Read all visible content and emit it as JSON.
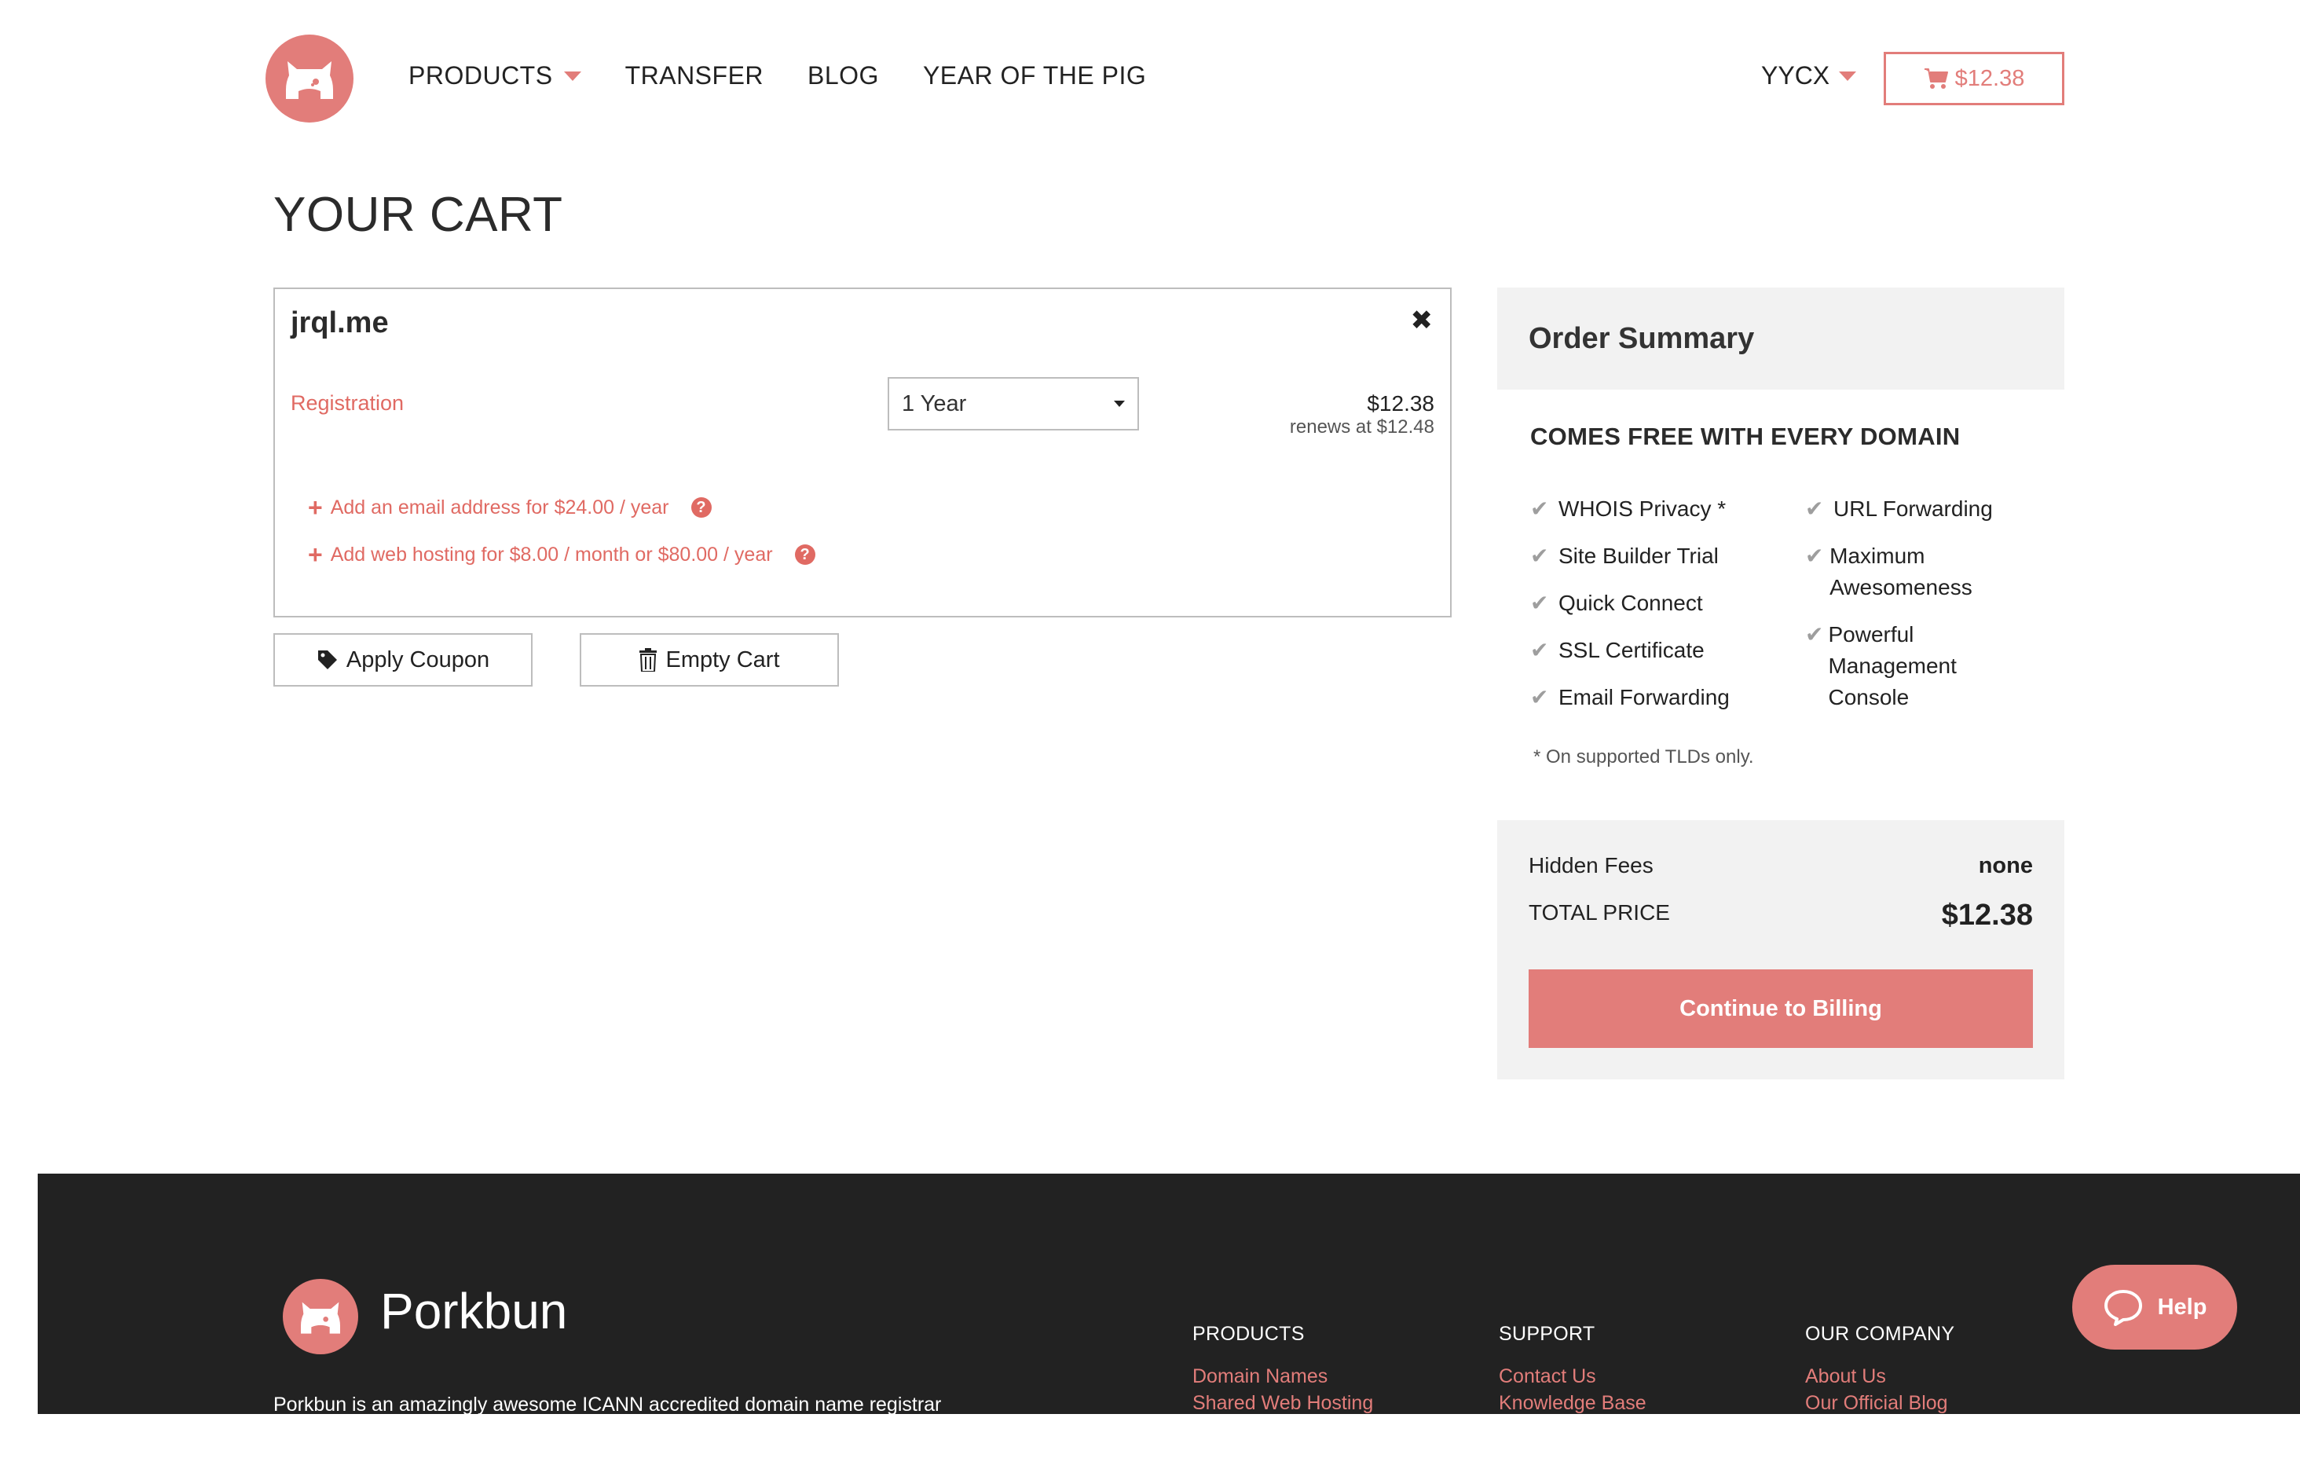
{
  "header": {
    "nav": [
      {
        "label": "PRODUCTS",
        "has_dropdown": true
      },
      {
        "label": "TRANSFER"
      },
      {
        "label": "BLOG"
      },
      {
        "label": "YEAR OF THE PIG"
      }
    ],
    "user_label": "YYCX",
    "cart_total": "$12.38"
  },
  "page_title": "YOUR CART",
  "cart_item": {
    "domain": "jrql.me",
    "type_label": "Registration",
    "period": "1 Year",
    "price": "$12.38",
    "renewal": "renews at $12.48",
    "addons": [
      {
        "label": "Add an email address for $24.00 / year"
      },
      {
        "label": "Add web hosting for $8.00 / month or $80.00 / year"
      }
    ]
  },
  "actions": {
    "apply_coupon": "Apply Coupon",
    "empty_cart": "Empty Cart"
  },
  "summary": {
    "title": "Order Summary",
    "free_title": "COMES FREE WITH EVERY DOMAIN",
    "features_left": [
      "WHOIS Privacy *",
      "Site Builder Trial",
      "Quick Connect",
      "SSL Certificate",
      "Email Forwarding"
    ],
    "features_right": [
      "URL Forwarding",
      "Maximum Awesomeness",
      "Powerful Management Console"
    ],
    "note": "* On supported TLDs only.",
    "hidden_fees_label": "Hidden Fees",
    "hidden_fees_value": "none",
    "total_label": "TOTAL PRICE",
    "total_value": "$12.38",
    "continue_label": "Continue to Billing"
  },
  "footer": {
    "brand": "Porkbun",
    "description": "Porkbun is an amazingly awesome ICANN accredited domain name registrar",
    "columns": [
      {
        "heading": "PRODUCTS",
        "links": [
          "Domain Names",
          "Shared Web Hosting"
        ]
      },
      {
        "heading": "SUPPORT",
        "links": [
          "Contact Us",
          "Knowledge Base"
        ]
      },
      {
        "heading": "OUR COMPANY",
        "links": [
          "About Us",
          "Our Official Blog"
        ]
      }
    ]
  },
  "help_label": "Help",
  "colors": {
    "accent": "#e27d7a",
    "link": "#e06a63",
    "footer_bg": "#222222",
    "panel_bg": "#f2f2f2"
  }
}
